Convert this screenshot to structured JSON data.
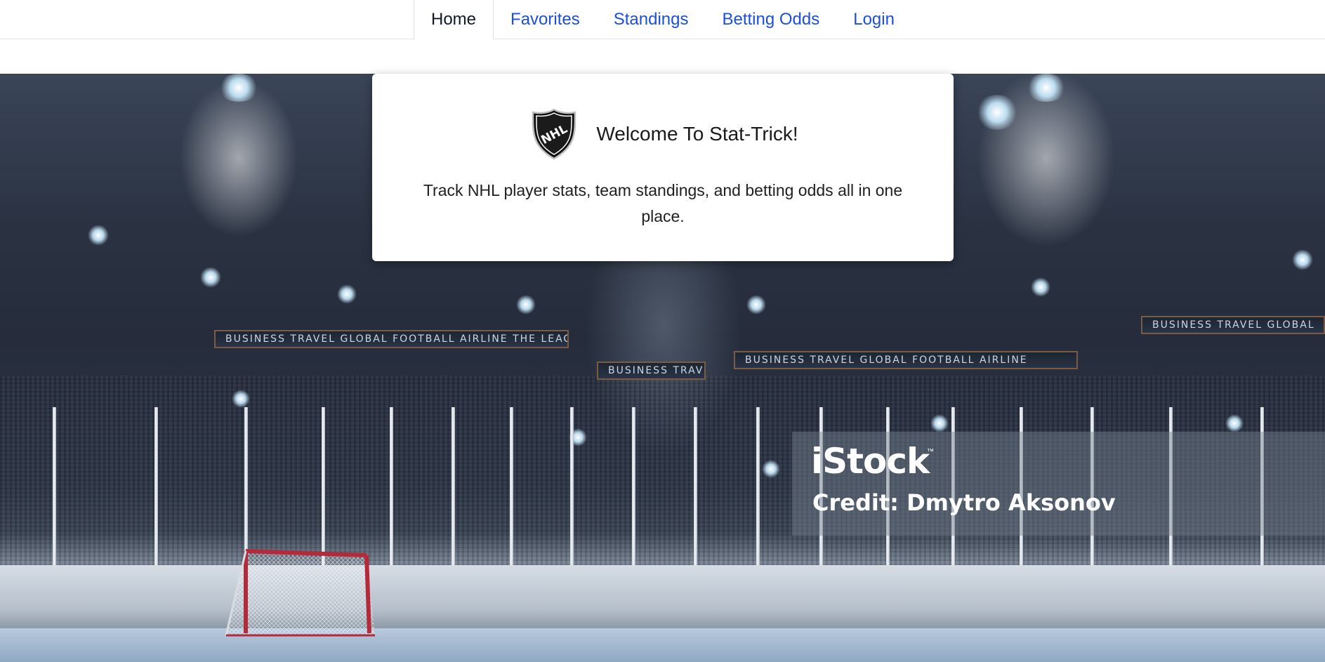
{
  "nav": {
    "tabs": [
      {
        "label": "Home",
        "active": true
      },
      {
        "label": "Favorites",
        "active": false
      },
      {
        "label": "Standings",
        "active": false
      },
      {
        "label": "Betting Odds",
        "active": false
      },
      {
        "label": "Login",
        "active": false
      }
    ]
  },
  "welcome": {
    "logo_icon": "nhl-shield-logo",
    "logo_text": "NHL",
    "title": "Welcome To Stat-Trick!",
    "description": "Track NHL player stats, team standings, and betting odds all in one place."
  },
  "hero": {
    "watermark": "iStock",
    "watermark_tm": "™",
    "credit": "Credit: Dmytro Aksonov",
    "banners": [
      "BUSINESS  TRAVEL  GLOBAL  FOOTBALL  AIRLINE  THE LEAGUE",
      "BUSINESS  TRAVEL",
      "BUSINESS  TRAVEL  GLOBAL  FOOTBALL  AIRLINE",
      "BUSINESS  TRAVEL  GLOBAL"
    ]
  },
  "colors": {
    "link": "#1a4fe0",
    "active_tab_text": "#111827",
    "card_bg": "#ffffff"
  }
}
